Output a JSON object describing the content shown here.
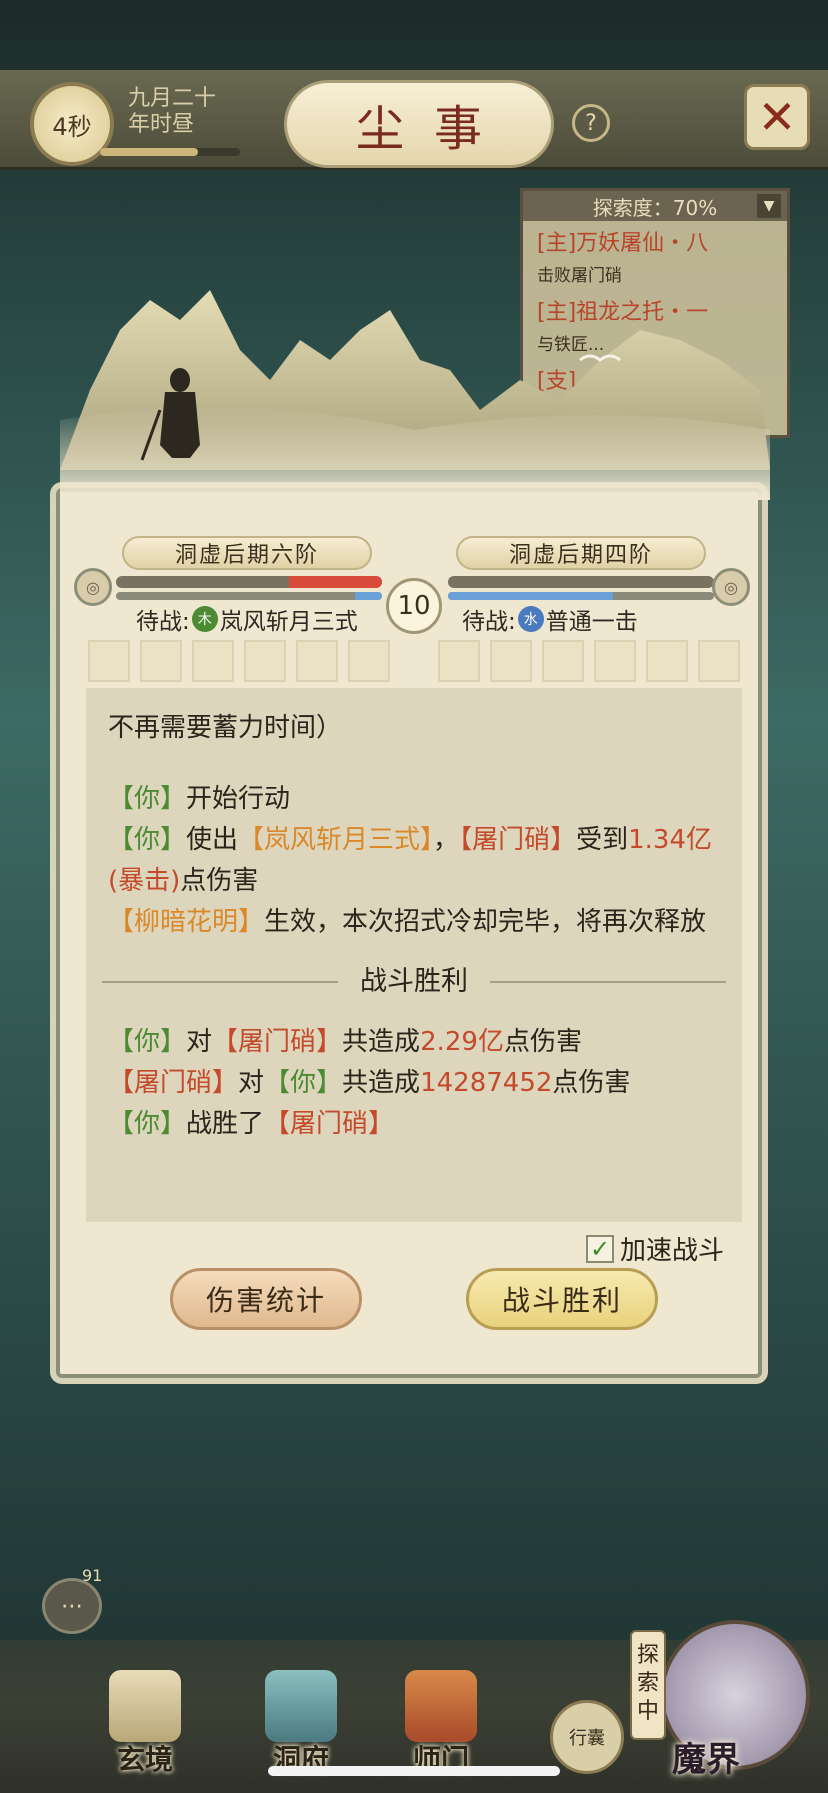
{
  "header": {
    "timer": "4秒",
    "date_line1": "九月二十",
    "date_line2": "年时昼",
    "day_progress": 0.7,
    "title": "尘事",
    "help": "?",
    "close": "✕"
  },
  "explore": {
    "label": "探索度：70%",
    "quests": [
      {
        "title": "[主]万妖屠仙・八",
        "desc": "击败屠门硝"
      },
      {
        "title": "[主]祖龙之托・一",
        "desc": "与铁匠..."
      },
      {
        "title": "[支]",
        "desc": ""
      }
    ]
  },
  "battle": {
    "player_rank": "洞虚后期六阶",
    "enemy_rank": "洞虚后期四阶",
    "player_hp": 0.35,
    "player_mp": 0.1,
    "enemy_hp": 1.0,
    "enemy_mp": 0.62,
    "round": "10",
    "player_status": "待战:",
    "player_element": "木",
    "player_skill": "岚风斩月三式",
    "enemy_status": "待战:",
    "enemy_element": "水",
    "enemy_skill": "普通一击"
  },
  "log": {
    "line0": "不再需要蓄力时间）",
    "b1": {
      "you": "【你】",
      "text": "开始行动"
    },
    "b2": {
      "you": "【你】",
      "t1": "使出",
      "skill": "【岚风斩月三式】",
      "t2": "，",
      "enemy": "【屠门硝】",
      "t3": "受到",
      "dmg": "1.34亿 (暴击)",
      "t4": "点伤害"
    },
    "b3": {
      "buff": "【柳暗花明】",
      "text": "生效，本次招式冷却完毕，将再次释放"
    },
    "divider": "战斗胜利",
    "s1": {
      "you": "【你】",
      "t1": "对",
      "enemy": "【屠门硝】",
      "t2": "共造成",
      "dmg": "2.29亿",
      "t3": "点伤害"
    },
    "s2": {
      "enemy": "【屠门硝】",
      "t1": "对",
      "you": "【你】",
      "t2": "共造成",
      "dmg": "14287452",
      "t3": "点伤害"
    },
    "s3": {
      "you": "【你】",
      "t1": "战胜了",
      "enemy": "【屠门硝】"
    }
  },
  "controls": {
    "speed_label": "加速战斗",
    "speed_checked": true,
    "stats_button": "伤害统计",
    "victory_button": "战斗胜利"
  },
  "chat": {
    "badge": "91"
  },
  "nav": {
    "items": [
      "玄境",
      "洞府",
      "师门"
    ],
    "bag": "行囊",
    "exploring": "探索中",
    "demon": "魔界"
  },
  "colors": {
    "player_hp": "#d84a3a",
    "enemy_hp": "#7a7260",
    "mp": "#6aa0d8",
    "ally_name": "#4c8a34",
    "enemy_name": "#c44a2c",
    "skill": "#d9882a"
  }
}
